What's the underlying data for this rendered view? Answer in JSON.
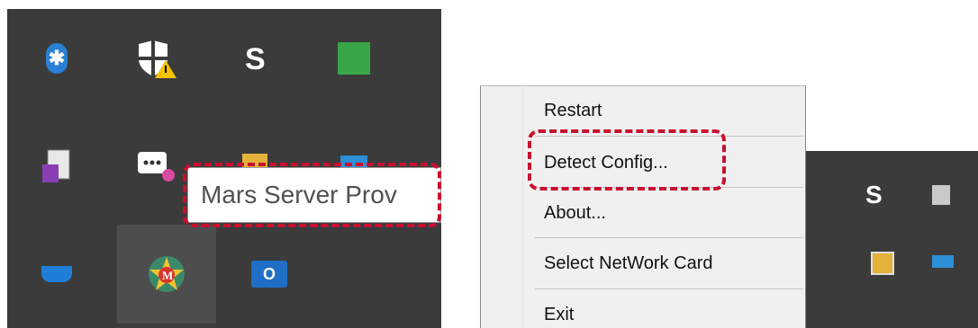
{
  "tooltip": {
    "text": "Mars Server Prov"
  },
  "context_menu": {
    "items": [
      {
        "label": "Restart"
      },
      {
        "label": "Detect Config..."
      },
      {
        "label": "About..."
      },
      {
        "label": "Select NetWork Card"
      },
      {
        "label": "Exit"
      }
    ]
  },
  "icons": {
    "bluetooth": "bluetooth-icon",
    "security": "windows-security-warning-icon",
    "outlook": "outlook-icon"
  },
  "outlook_label": "O",
  "colors": {
    "highlight": "#c8102e",
    "taskbar": "#3b3b3b"
  }
}
